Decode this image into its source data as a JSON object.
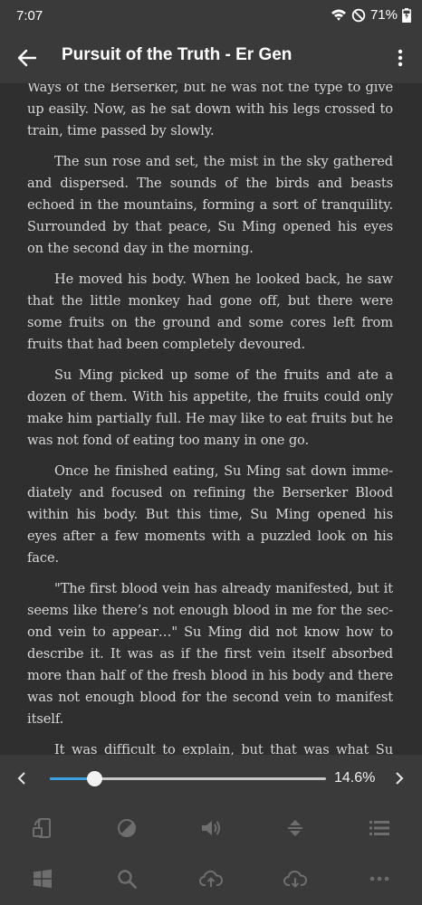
{
  "status": {
    "time": "7:07",
    "battery": "71%"
  },
  "appbar": {
    "title": "Pursuit of the Truth - Er Gen"
  },
  "reader": {
    "paragraphs": [
      {
        "text": "Ways of the Berserker, but he was not the type to give up easily. Now, as he sat down with his legs crossed to train, time passed by slowly.",
        "continued": true
      },
      {
        "text": "The sun rose and set, the mist in the sky gathered and dispersed. The sounds of the birds and beasts echoed in the mountains, forming a sort of tranquility. Surrounded by that peace, Su Ming opened his eyes on the second day in the morning."
      },
      {
        "text": "He moved his body. When he looked back, he saw that the little monkey had gone off, but there were some fruits on the ground and some cores left from fruits that had been completely devoured."
      },
      {
        "text": "Su Ming picked up some of the fruits and ate a dozen of them. With his appetite, the fruits could only make him partially full. He may like to eat fruits but he was not fond of eating too many in one go."
      },
      {
        "text": "Once he finished eating, Su Ming sat down imme­diately and focused on refining the Berserker Blood within his body. But this time, Su Ming opened his eyes after a few moments with a puzzled look on his face."
      },
      {
        "text": "\"The first blood vein has already manifested, but it seems like there’s not enough blood in me for the sec­ond vein to appear…\" Su Ming did not know how to de­scribe it. It was as if the first vein itself absorbed more than half of the fresh blood in his body and there was not enough blood for the second vein to manifest itself."
      },
      {
        "text": "It was difficult to explain, but that was what Su Ming felt at this moment."
      }
    ]
  },
  "progress": {
    "value": 0.146,
    "label": "14.6%"
  },
  "toolbar": {
    "row1": [
      "screen-rotation-icon",
      "contrast-icon",
      "volume-icon",
      "vertical-spacing-icon",
      "list-icon"
    ],
    "row2": [
      "windows-icon",
      "search-icon",
      "cloud-upload-icon",
      "cloud-download-icon",
      "more-horizontal-icon"
    ]
  },
  "colors": {
    "accent": "#3aa0e0",
    "bar": "#3a3a3a",
    "page": "#2f2f2f",
    "text": "#d8d8d8"
  }
}
